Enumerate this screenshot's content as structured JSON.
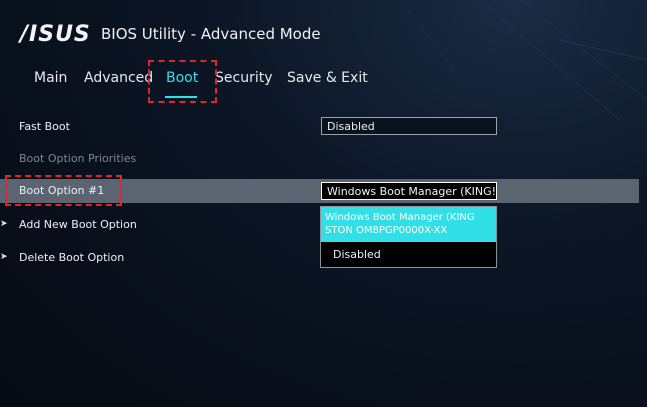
{
  "header": {
    "logo": "/ISUS",
    "title": "BIOS Utility - Advanced Mode"
  },
  "tabs": [
    {
      "label": "Main"
    },
    {
      "label": "Advanced"
    },
    {
      "label": "Boot"
    },
    {
      "label": "Security"
    },
    {
      "label": "Save & Exit"
    }
  ],
  "settings": {
    "fast_boot": {
      "label": "Fast Boot",
      "value": "Disabled"
    },
    "section_header": "Boot Option Priorities",
    "boot_option_1": {
      "label": "Boot Option #1",
      "value": "Windows Boot Manager (KING!"
    },
    "add_new": {
      "label": "Add New Boot Option"
    },
    "delete": {
      "label": "Delete Boot Option"
    }
  },
  "dropdown": {
    "options": [
      {
        "label": "Windows Boot Manager (KING STON OM8PGP0000X-XX"
      },
      {
        "label": "Disabled"
      }
    ]
  },
  "colors": {
    "accent": "#30e0e6",
    "highlight": "#e0262a",
    "selected_row": "#5b6471"
  }
}
